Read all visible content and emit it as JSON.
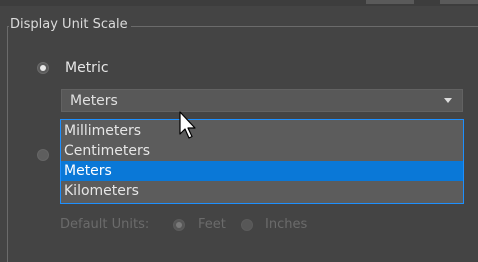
{
  "group": {
    "title": "Display Unit Scale"
  },
  "metric": {
    "label": "Metric",
    "selected": true
  },
  "units_combo": {
    "value": "Meters",
    "options": [
      "Millimeters",
      "Centimeters",
      "Meters",
      "Kilometers"
    ],
    "selected_index": 2
  },
  "default_units": {
    "label": "Default Units:",
    "feet_label": "Feet",
    "inches_label": "Inches",
    "selected": "Feet"
  },
  "colors": {
    "panel_background": "#444444",
    "selection_highlight": "#0a78d7",
    "dropdown_border": "#1e90ff"
  },
  "icons": {
    "pointer": "mouse-pointer-icon",
    "dropdown": "dropdown-arrow-icon"
  }
}
